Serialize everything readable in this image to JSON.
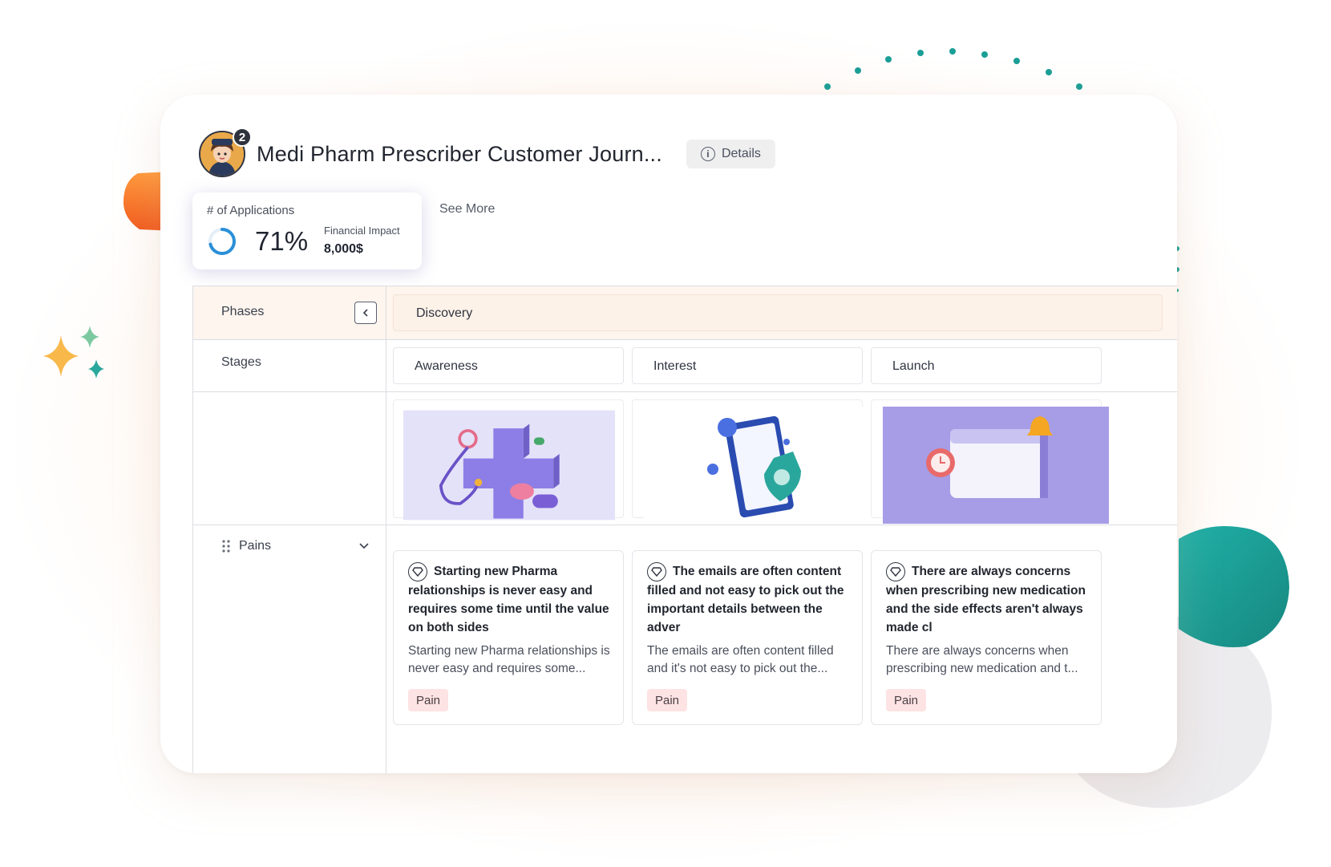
{
  "journey": {
    "title": "Medi Pharm Prescriber Customer Journ...",
    "details_label": "Details",
    "avatar_badge": "2"
  },
  "kpi": {
    "label": "# of Applications",
    "value": "71%",
    "percent": 71,
    "financial_label": "Financial Impact",
    "financial_value": "8,000$",
    "see_more": "See More"
  },
  "rows": {
    "phases_label": "Phases",
    "stages_label": "Stages",
    "pains_label": "Pains"
  },
  "phases": [
    {
      "label": "Discovery"
    }
  ],
  "stages": [
    {
      "label": "Awareness",
      "image": "medical-cross-stethoscope-illustration"
    },
    {
      "label": "Interest",
      "image": "clipboard-shield-illustration"
    },
    {
      "label": "Launch",
      "image": "calendar-alarm-illustration"
    }
  ],
  "pains": [
    {
      "title": "Starting new Pharma relationships is never easy and requires some time until the value on both sides",
      "body": "Starting new Pharma relationships is never easy and requires some...",
      "badge": "Pain"
    },
    {
      "title": "The emails are often content filled and not easy to pick out the important details between the adver",
      "body": "The emails are often content filled and it's not easy to pick out the...",
      "badge": "Pain"
    },
    {
      "title": "There are always concerns when prescribing new medication and the side effects aren't always made cl",
      "body": "There are always concerns when prescribing new medication and t...",
      "badge": "Pain"
    }
  ],
  "colors": {
    "accent_teal": "#1a9e96",
    "accent_orange": "#f5771f",
    "phase_bg": "#fdf2e8",
    "pain_badge_bg": "#fde3e3",
    "ring_blue": "#2a8fd8"
  }
}
